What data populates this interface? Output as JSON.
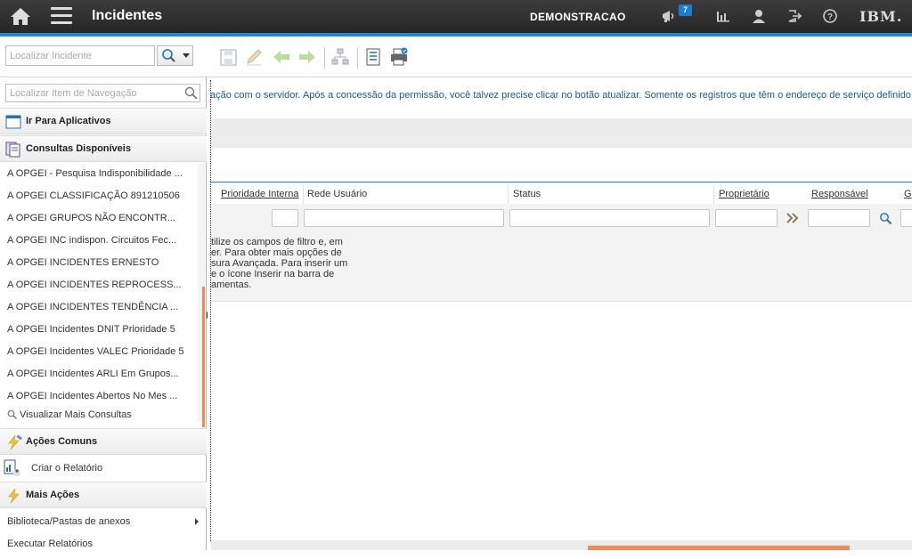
{
  "header": {
    "title": "Incidentes",
    "user": "DEMONSTRACAO",
    "notification_count": "7",
    "logo": "IBM.",
    "icons": [
      "home-icon",
      "menu-icon",
      "megaphone-icon",
      "chart-icon",
      "user-icon",
      "logout-icon",
      "help-icon"
    ]
  },
  "toolbar": {
    "search_placeholder": "Localizar Incidente",
    "tools": [
      "save-icon",
      "edit-icon",
      "back-icon",
      "forward-icon",
      "route-icon",
      "list-icon",
      "print-icon"
    ]
  },
  "nav": {
    "search_placeholder": "Localizar Item de Navegação",
    "goto_apps": "Ir Para Aplicativos",
    "queries_header": "Consultas Disponíveis",
    "queries": [
      "A OPGEI - Pesquisa Indisponibilidade ...",
      "A OPGEI CLASSIFICAÇÃO 891210506",
      "A OPGEI GRUPOS NÃO ENCONTR...",
      "A OPGEI INC indispon. Circuitos Fec...",
      "A OPGEI INCIDENTES ERNESTO",
      "A OPGEI INCIDENTES REPROCESS...",
      "A OPGEI INCIDENTES TENDÊNCIA ...",
      "A OPGEI Incidentes DNIT Prioridade 5",
      "A OPGEI Incidentes VALEC Prioridade 5",
      "A OPGEI Incidentes ARLI Em Grupos...",
      "A OPGEI Incidentes Abertos No Mes ..."
    ],
    "more_queries": "Visualizar Mais Consultas",
    "common_actions_header": "Ações Comuns",
    "create_report": "Criar o Relatório",
    "more_actions_header": "Mais Ações",
    "attachments": "Biblioteca/Pastas de anexos",
    "run_reports": "Executar Relatórios"
  },
  "main": {
    "message": "ação com o servidor. Após a concessão da permissão, você talvez precise clicar no botão atualizar. Somente os registros que têm o endereço de serviço definido",
    "columns": {
      "prioridade": "Prioridade Interna",
      "rede": "Rede Usuário",
      "status": "Status",
      "proprietario": "Proprietário",
      "responsavel": "Responsável",
      "next": "G"
    },
    "info_lines": [
      "tilize os campos de filtro e, em",
      "er. Para obter mais opções de",
      "sura Avançada. Para inserir um",
      "e o ícone Inserir na barra de",
      "amentas."
    ]
  }
}
